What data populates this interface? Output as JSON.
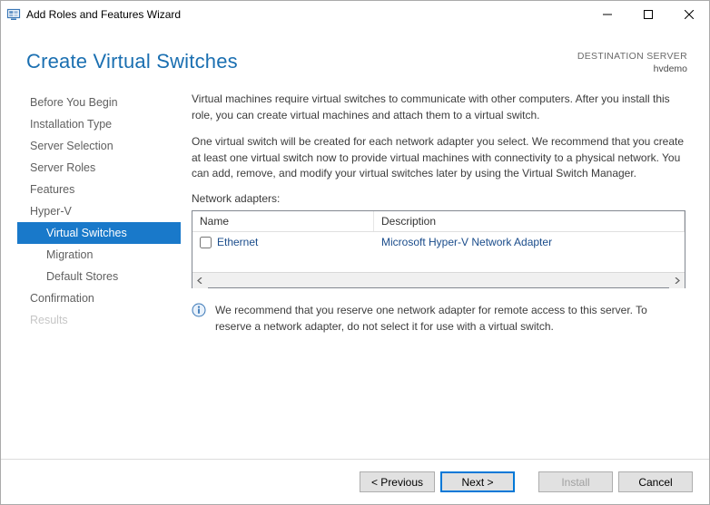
{
  "window": {
    "title": "Add Roles and Features Wizard"
  },
  "header": {
    "pagetitle": "Create Virtual Switches",
    "dest_label": "DESTINATION SERVER",
    "dest_host": "hvdemo"
  },
  "nav": {
    "items": [
      {
        "label": "Before You Begin",
        "sub": false,
        "selected": false,
        "disabled": false
      },
      {
        "label": "Installation Type",
        "sub": false,
        "selected": false,
        "disabled": false
      },
      {
        "label": "Server Selection",
        "sub": false,
        "selected": false,
        "disabled": false
      },
      {
        "label": "Server Roles",
        "sub": false,
        "selected": false,
        "disabled": false
      },
      {
        "label": "Features",
        "sub": false,
        "selected": false,
        "disabled": false
      },
      {
        "label": "Hyper-V",
        "sub": false,
        "selected": false,
        "disabled": false
      },
      {
        "label": "Virtual Switches",
        "sub": true,
        "selected": true,
        "disabled": false
      },
      {
        "label": "Migration",
        "sub": true,
        "selected": false,
        "disabled": false
      },
      {
        "label": "Default Stores",
        "sub": true,
        "selected": false,
        "disabled": false
      },
      {
        "label": "Confirmation",
        "sub": false,
        "selected": false,
        "disabled": false
      },
      {
        "label": "Results",
        "sub": false,
        "selected": false,
        "disabled": true
      }
    ]
  },
  "main": {
    "para1": "Virtual machines require virtual switches to communicate with other computers. After you install this role, you can create virtual machines and attach them to a virtual switch.",
    "para2": "One virtual switch will be created for each network adapter you select. We recommend that you create at least one virtual switch now to provide virtual machines with connectivity to a physical network. You can add, remove, and modify your virtual switches later by using the Virtual Switch Manager.",
    "adapters_label": "Network adapters:",
    "grid": {
      "col_name": "Name",
      "col_desc": "Description",
      "rows": [
        {
          "checked": false,
          "name": "Ethernet",
          "desc": "Microsoft Hyper-V Network Adapter"
        }
      ]
    },
    "info": "We recommend that you reserve one network adapter for remote access to this server. To reserve a network adapter, do not select it for use with a virtual switch."
  },
  "footer": {
    "prev": "< Previous",
    "next": "Next >",
    "install": "Install",
    "cancel": "Cancel"
  }
}
